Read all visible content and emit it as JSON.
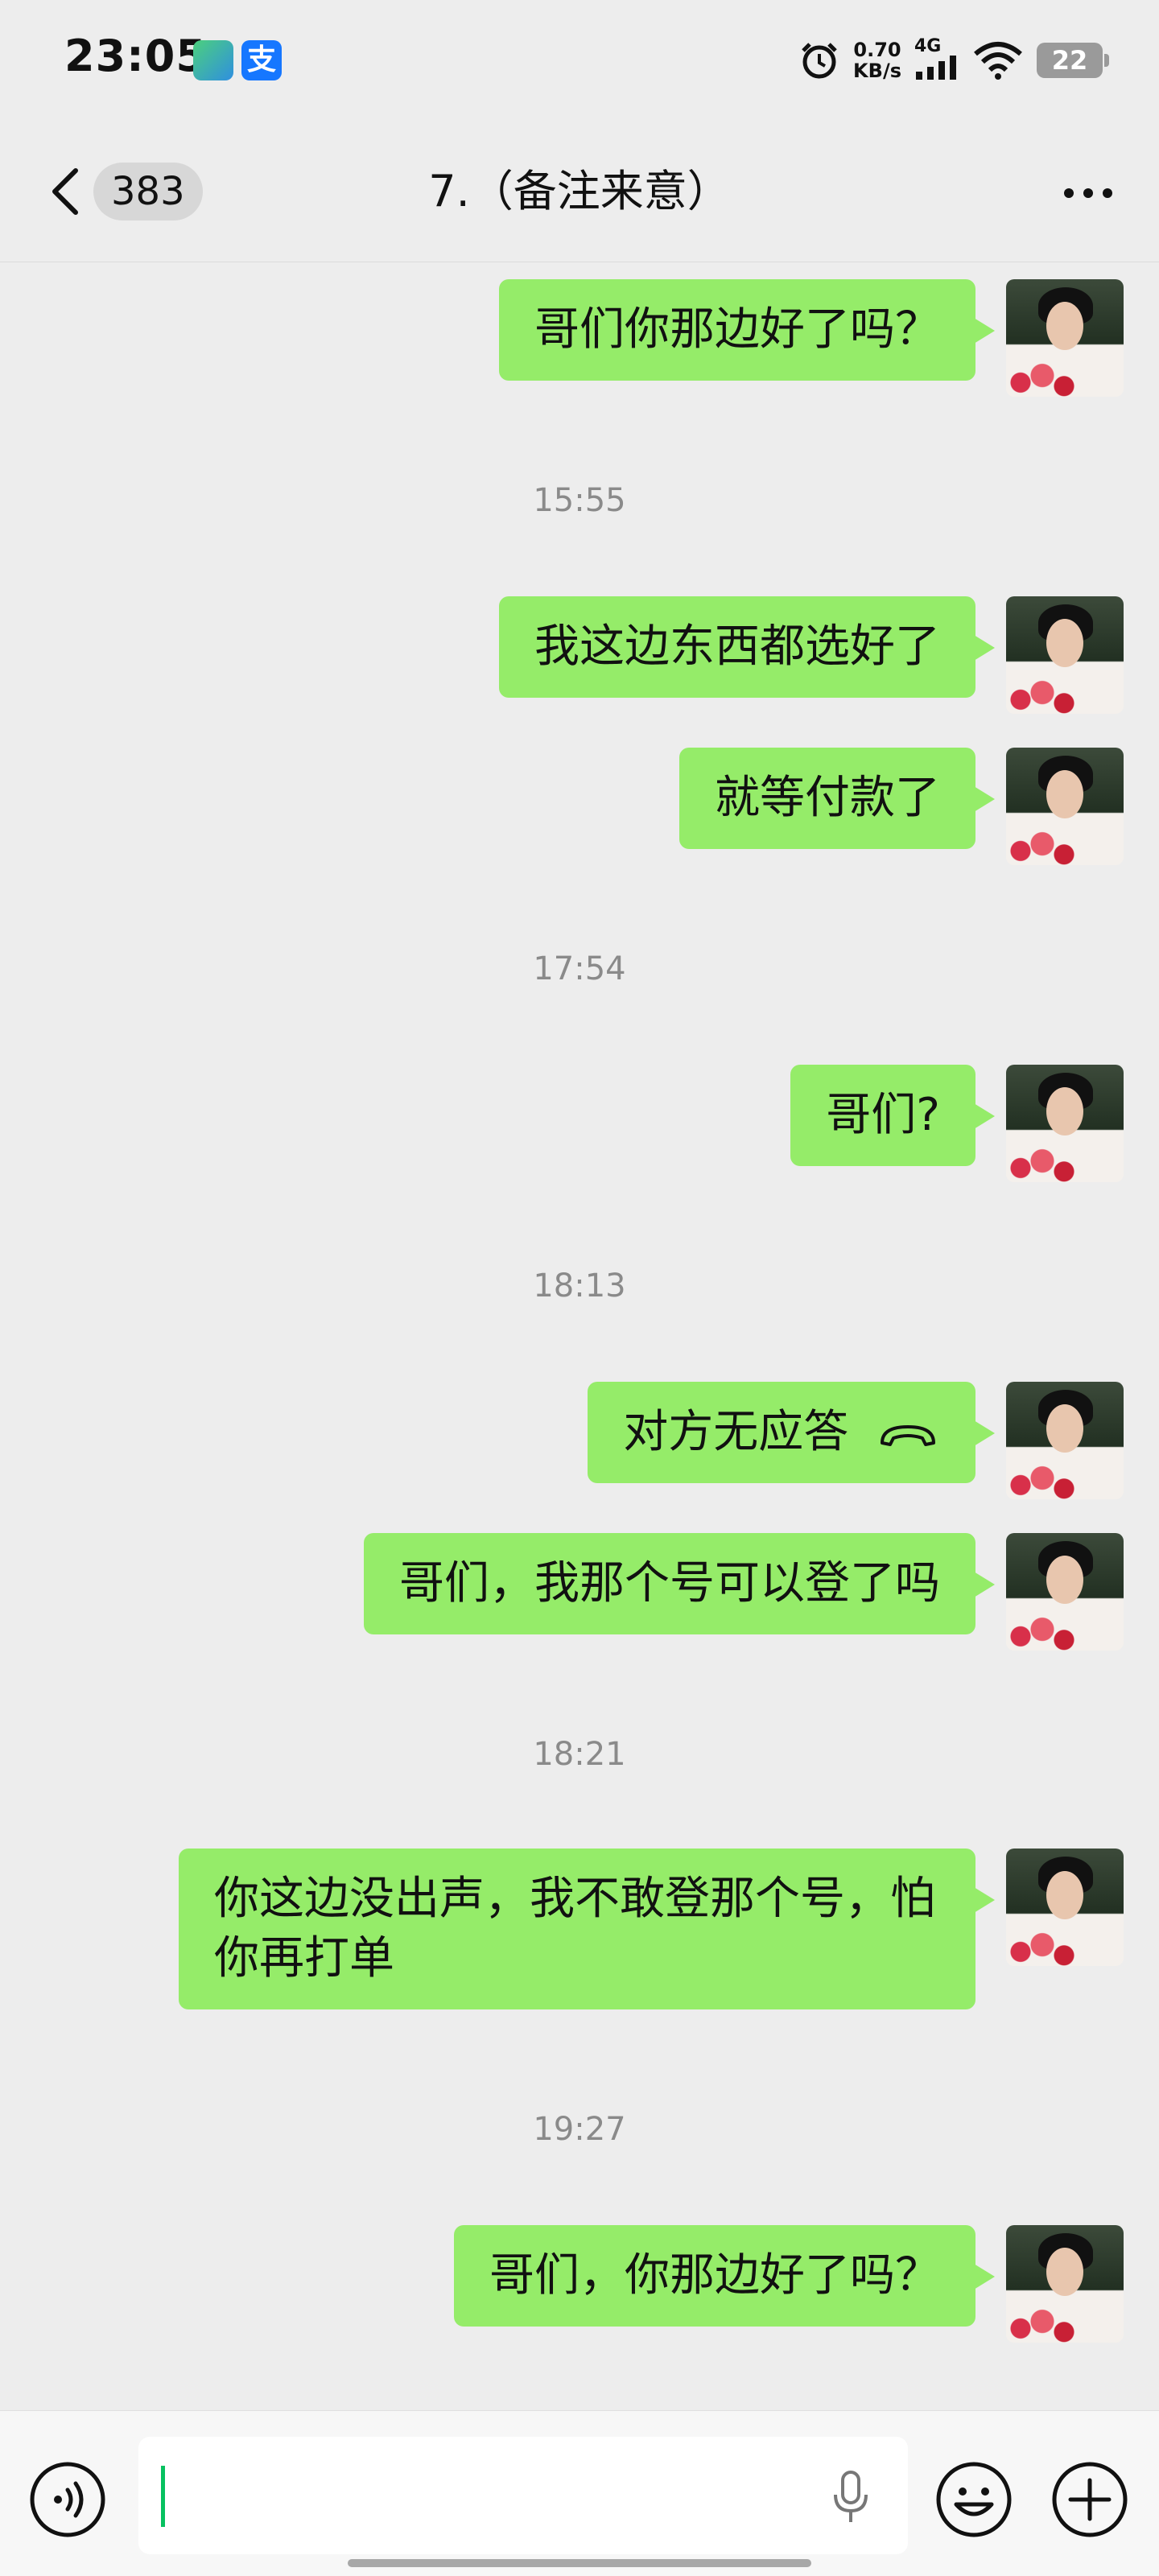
{
  "status_bar": {
    "time": "23:05",
    "app_icon_2": "支",
    "net_speed_value": "0.70",
    "net_speed_unit": "KB/s",
    "network": "4G",
    "battery": "22"
  },
  "header": {
    "unread_count": "383",
    "title": "7.（备注来意）"
  },
  "messages": [
    {
      "text": "哥们你那边好了吗？"
    },
    {
      "timestamp": "15:55"
    },
    {
      "text": "我这边东西都选好了"
    },
    {
      "text": "就等付款了"
    },
    {
      "timestamp": "17:54"
    },
    {
      "text": "哥们?"
    },
    {
      "timestamp": "18:13"
    },
    {
      "text": "对方无应答"
    },
    {
      "text": "哥们，我那个号可以登了吗"
    },
    {
      "timestamp": "18:21"
    },
    {
      "text": "你这边没出声，我不敢登那个号，怕你再打单"
    },
    {
      "timestamp": "19:27"
    },
    {
      "text": "哥们，你那边好了吗？"
    }
  ],
  "input_bar": {
    "voice_icon": "voice-icon",
    "emoji_icon": "emoji-icon",
    "plus_icon": "plus-icon",
    "mic_icon": "mic-icon"
  },
  "colors": {
    "background": "#ededed",
    "bubble_self": "#95ec69",
    "caret": "#07c160"
  }
}
